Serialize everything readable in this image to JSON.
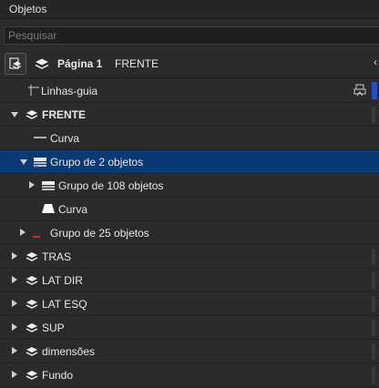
{
  "panel": {
    "title": "Objetos"
  },
  "search": {
    "placeholder": "Pesquisar",
    "value": ""
  },
  "page": {
    "label": "Página 1",
    "name": "FRENTE"
  },
  "tree": {
    "guides": "Linhas-guia",
    "frente": "FRENTE",
    "curva1": "Curva",
    "grupo2": "Grupo de 2 objetos",
    "grupo108": "Grupo de 108 objetos",
    "curva2": "Curva",
    "grupo25": "Grupo de 25 objetos",
    "tras": "TRAS",
    "latdir": "LAT DIR",
    "latesq": "LAT ESQ",
    "sup": "SUP",
    "dimensoes": "dimensões",
    "fundo": "Fundo"
  },
  "colors": {
    "selection": "#0a3a73",
    "guide_color": "#1f4fd8",
    "red_accent": "#c0392b"
  }
}
